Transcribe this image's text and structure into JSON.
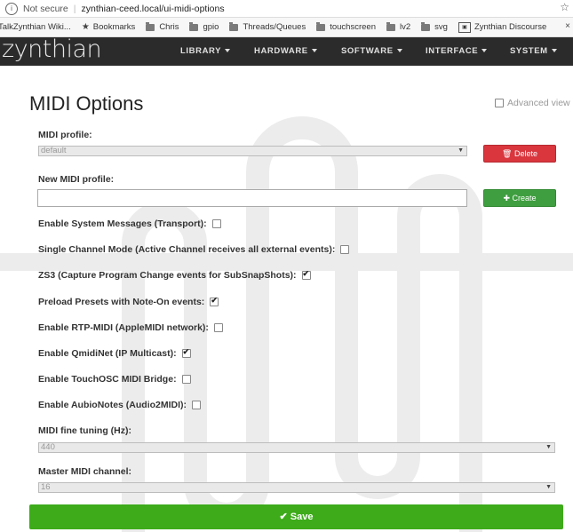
{
  "browser": {
    "security_label": "Not secure",
    "url": "zynthian-ceed.local/ui-midi-options",
    "bookmarks": [
      "TalkZynthian Wiki...",
      "Bookmarks",
      "Chris",
      "gpio",
      "Threads/Queues",
      "touchscreen",
      "lv2",
      "svg",
      "Zynthian Discourse"
    ]
  },
  "nav": {
    "brand": "zynthian",
    "items": [
      "LIBRARY",
      "HARDWARE",
      "SOFTWARE",
      "INTERFACE",
      "SYSTEM"
    ]
  },
  "page": {
    "title": "MIDI Options",
    "advanced_view": "Advanced view",
    "midi_profile_label": "MIDI profile:",
    "midi_profile_value": "default",
    "delete_label": "Delete",
    "new_profile_label": "New MIDI profile:",
    "new_profile_value": "",
    "create_label": "Create",
    "options": [
      {
        "label": "Enable System Messages (Transport):",
        "checked": false
      },
      {
        "label": "Single Channel Mode (Active Channel receives all external events):",
        "checked": false
      },
      {
        "label": "ZS3 (Capture Program Change events for SubSnapShots):",
        "checked": true
      },
      {
        "label": "Preload Presets with Note-On events:",
        "checked": true
      },
      {
        "label": "Enable RTP-MIDI (AppleMIDI network):",
        "checked": false
      },
      {
        "label": "Enable QmidiNet (IP Multicast):",
        "checked": true
      },
      {
        "label": "Enable TouchOSC MIDI Bridge:",
        "checked": false
      },
      {
        "label": "Enable AubioNotes (Audio2MIDI):",
        "checked": false
      }
    ],
    "fine_tuning_label": "MIDI fine tuning (Hz):",
    "fine_tuning_value": "440",
    "master_channel_label": "Master MIDI channel:",
    "master_channel_value": "16",
    "save_label": "Save"
  },
  "colors": {
    "delete": "#d9363e",
    "create": "#3f9e3f",
    "save": "#3dab1a",
    "navbar": "#2b2b2b"
  }
}
